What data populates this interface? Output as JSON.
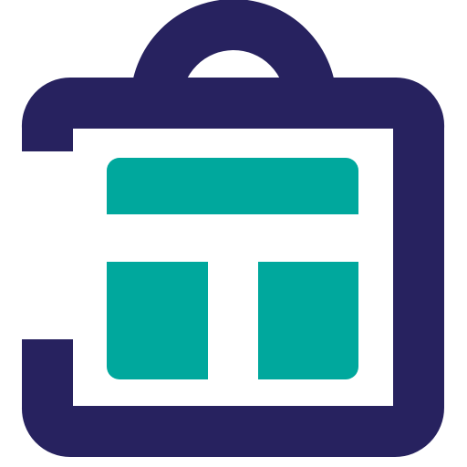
{
  "logo": {
    "icon": "bag-layout-icon",
    "colors": {
      "outline": "#27225F",
      "panels": "#00A89D",
      "background": "#FFFFFF"
    }
  }
}
